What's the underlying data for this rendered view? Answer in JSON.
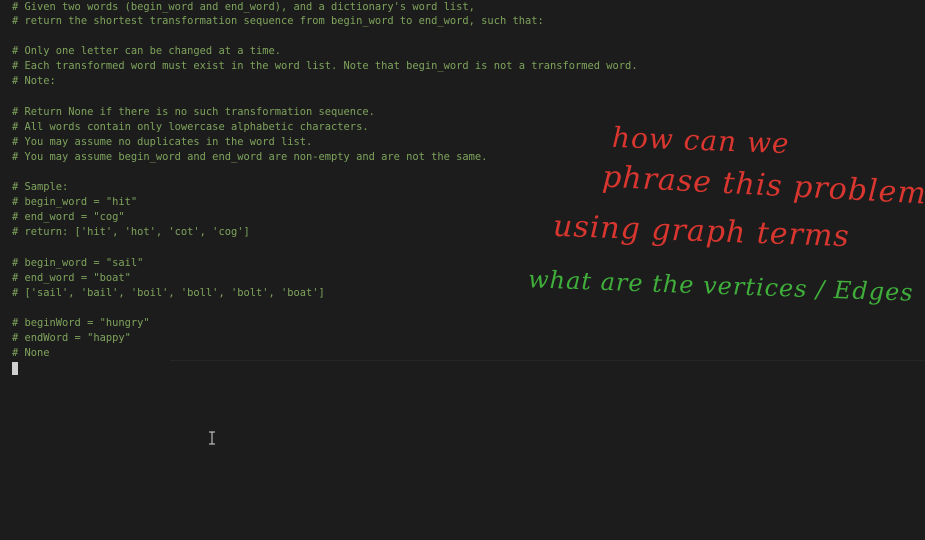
{
  "editor": {
    "lines": [
      "# Given two words (begin_word and end_word), and a dictionary's word list,",
      "# return the shortest transformation sequence from begin_word to end_word, such that:",
      "",
      "# Only one letter can be changed at a time.",
      "# Each transformed word must exist in the word list. Note that begin_word is not a transformed word.",
      "# Note:",
      "",
      "# Return None if there is no such transformation sequence.",
      "# All words contain only lowercase alphabetic characters.",
      "# You may assume no duplicates in the word list.",
      "# You may assume begin_word and end_word are non-empty and are not the same.",
      "",
      "# Sample:",
      "# begin_word = \"hit\"",
      "# end_word = \"cog\"",
      "# return: ['hit', 'hot', 'cot', 'cog']",
      "",
      "# begin_word = \"sail\"",
      "# end_word = \"boat\"",
      "# ['sail', 'bail', 'boil', 'boll', 'bolt', 'boat']",
      "",
      "# beginWord = \"hungry\"",
      "# endWord = \"happy\"",
      "# None"
    ]
  },
  "annotations": {
    "line1": "how can we",
    "line2": "phrase this problem",
    "line3": "using graph terms",
    "line4": "what are the vertices / Edges"
  },
  "colors": {
    "background": "#1c1c1c",
    "comment": "#7ea35c",
    "ink_red": "#d8362f",
    "ink_green": "#3fae3a"
  }
}
